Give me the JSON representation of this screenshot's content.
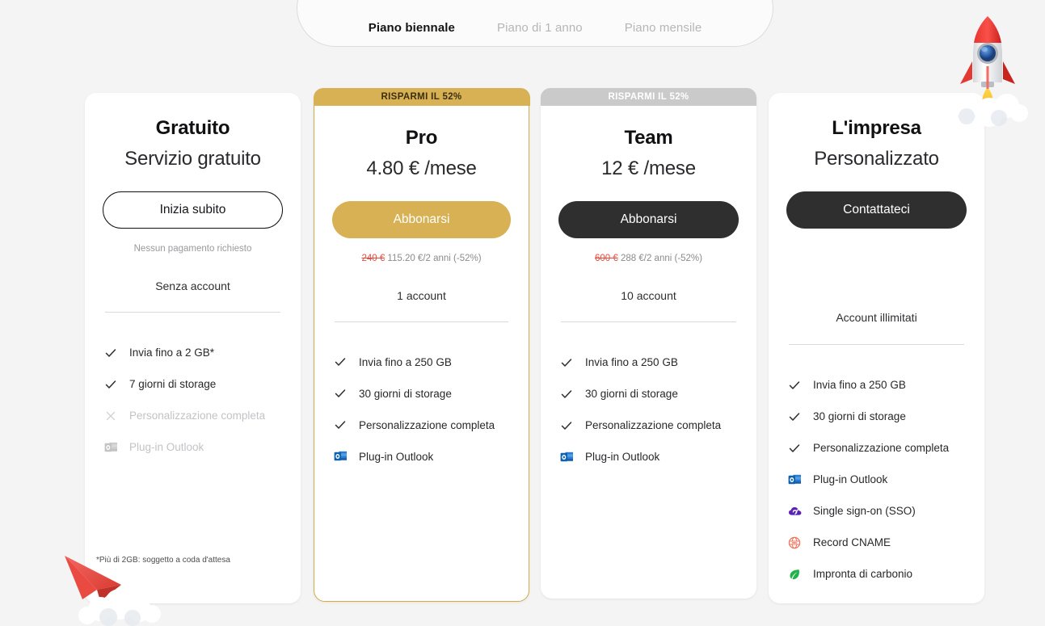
{
  "tabs": [
    {
      "label": "Piano biennale",
      "active": true
    },
    {
      "label": "Piano di 1 anno",
      "active": false
    },
    {
      "label": "Piano mensile",
      "active": false
    }
  ],
  "colors": {
    "page_bg": "#f4f4f4",
    "card_bg": "#ffffff",
    "gold": "#d8b154",
    "grey_ribbon": "#cacaca",
    "dark_button": "#2f2f2f",
    "strike_red": "#e8493f",
    "muted_text": "#9a9a9e"
  },
  "plans": [
    {
      "id": "free",
      "ribbon": null,
      "name": "Gratuito",
      "price": "Servizio gratuito",
      "cta": "Inizia subito",
      "cta_style": "outline",
      "note_plain": "Nessun pagamento richiesto",
      "note_old": "",
      "note_new": "",
      "accounts": "Senza account",
      "features": [
        {
          "icon": "check-icon",
          "label": "Invia fino a 2 GB*",
          "enabled": true
        },
        {
          "icon": "check-icon",
          "label": "7 giorni di storage",
          "enabled": true
        },
        {
          "icon": "cross-icon",
          "label": "Personalizzazione completa",
          "enabled": false
        },
        {
          "icon": "outlook-icon",
          "label": "Plug-in Outlook",
          "enabled": false
        }
      ],
      "footnote": "*Più di 2GB: soggetto a coda d'attesa"
    },
    {
      "id": "pro",
      "ribbon": "RISPARMI IL 52%",
      "ribbon_style": "gold",
      "name": "Pro",
      "price": "4.80 € /mese",
      "cta": "Abbonarsi",
      "cta_style": "gold",
      "note_plain": "",
      "note_old": "240 €",
      "note_new": "115.20 €/2 anni (-52%)",
      "accounts": "1 account",
      "features": [
        {
          "icon": "check-icon",
          "label": "Invia fino a 250 GB",
          "enabled": true
        },
        {
          "icon": "check-icon",
          "label": "30 giorni di storage",
          "enabled": true
        },
        {
          "icon": "check-icon",
          "label": "Personalizzazione completa",
          "enabled": true
        },
        {
          "icon": "outlook-icon",
          "label": "Plug-in Outlook",
          "enabled": true
        }
      ],
      "footnote": ""
    },
    {
      "id": "team",
      "ribbon": "RISPARMI IL 52%",
      "ribbon_style": "grey",
      "name": "Team",
      "price": "12 € /mese",
      "cta": "Abbonarsi",
      "cta_style": "dark",
      "note_plain": "",
      "note_old": "600 €",
      "note_new": "288 €/2 anni (-52%)",
      "accounts": "10 account",
      "features": [
        {
          "icon": "check-icon",
          "label": "Invia fino a 250 GB",
          "enabled": true
        },
        {
          "icon": "check-icon",
          "label": "30 giorni di storage",
          "enabled": true
        },
        {
          "icon": "check-icon",
          "label": "Personalizzazione completa",
          "enabled": true
        },
        {
          "icon": "outlook-icon",
          "label": "Plug-in Outlook",
          "enabled": true
        }
      ],
      "footnote": ""
    },
    {
      "id": "enterprise",
      "ribbon": null,
      "name": "L'impresa",
      "price": "Personalizzato",
      "cta": "Contattateci",
      "cta_style": "dark",
      "note_plain": "",
      "note_old": "",
      "note_new": "",
      "accounts": "Account illimitati",
      "features": [
        {
          "icon": "check-icon",
          "label": "Invia fino a 250 GB",
          "enabled": true
        },
        {
          "icon": "check-icon",
          "label": "30 giorni di storage",
          "enabled": true
        },
        {
          "icon": "check-icon",
          "label": "Personalizzazione completa",
          "enabled": true
        },
        {
          "icon": "outlook-icon",
          "label": "Plug-in Outlook",
          "enabled": true
        },
        {
          "icon": "sso-cloud-icon",
          "label": "Single sign-on (SSO)",
          "enabled": true
        },
        {
          "icon": "dns-globe-icon",
          "label": "Record CNAME",
          "enabled": true
        },
        {
          "icon": "leaf-icon",
          "label": "Impronta di carbonio",
          "enabled": true
        }
      ],
      "footnote": ""
    }
  ],
  "decorations": [
    {
      "name": "rocket-illustration"
    },
    {
      "name": "paper-plane-illustration"
    }
  ]
}
